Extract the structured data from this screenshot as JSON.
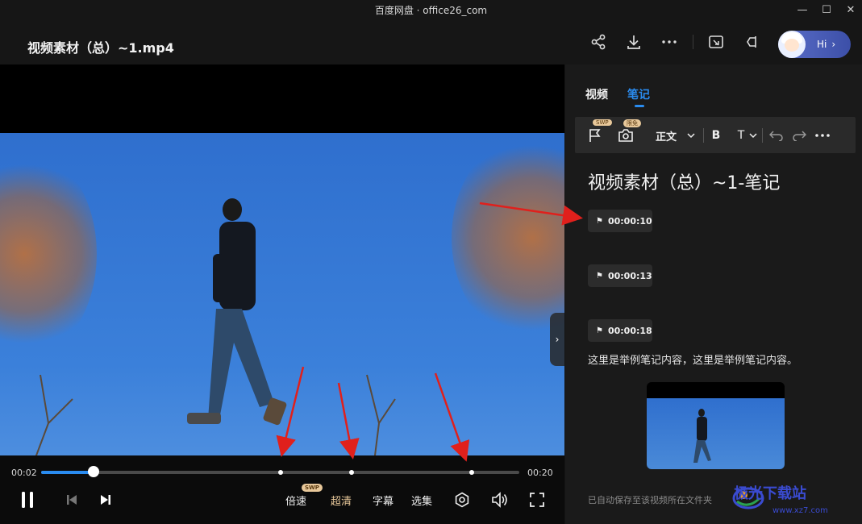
{
  "window": {
    "title": "百度网盘 · office26_com",
    "min": "—",
    "max": "☐",
    "close": "✕"
  },
  "header": {
    "video_title": "视频素材（总）~1.mp4",
    "hi_label": "Hi",
    "hi_chevron": "›"
  },
  "player": {
    "current_time": "00:02",
    "total_time": "00:20",
    "progress_fraction": 0.11,
    "note_markers": [
      0.5,
      0.65,
      0.9
    ],
    "controls": {
      "speed": "倍速",
      "quality": "超清",
      "subtitle": "字幕",
      "episodes": "选集",
      "swp_badge": "SWP"
    },
    "expand_tab": "›"
  },
  "panel": {
    "tabs": [
      "视频",
      "笔记"
    ],
    "active_tab": "笔记",
    "toolbar": {
      "swp_badge": "SWP",
      "free_badge": "限免",
      "text_style": "正文",
      "bold": "B",
      "font": "T"
    },
    "note_title": "视频素材（总）~1-笔记",
    "timestamps": [
      "00:00:10",
      "00:00:13",
      "00:00:18"
    ],
    "note_text": "这里是举例笔记内容，这里是举例笔记内容。",
    "autosave": "已自动保存至该视频所在文件夹"
  },
  "watermark": {
    "main": "极光下载站",
    "sub": "www.xz7.com"
  },
  "colors": {
    "accent": "#2a8cf0",
    "annotation_arrow": "#e0201c"
  }
}
